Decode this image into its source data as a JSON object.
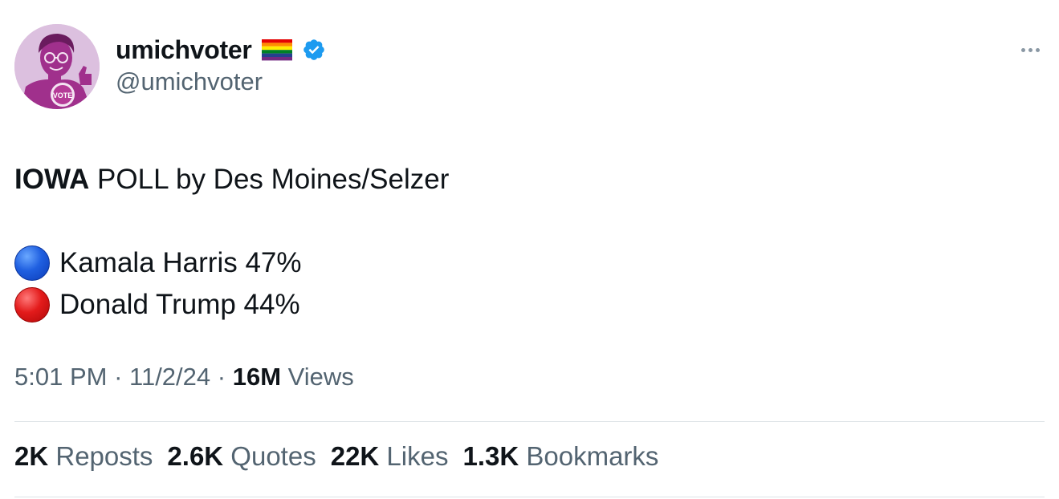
{
  "author": {
    "display_name": "umichvoter",
    "handle": "@umichvoter",
    "avatar_icon": "cartoon-avatar-vote",
    "avatar_badge_text": "VOTE",
    "flag_icon": "rainbow-flag-icon",
    "verified_icon": "verified-badge-icon",
    "verified_color": "#1d9bf0"
  },
  "tweet": {
    "title_bold": "IOWA",
    "title_rest": " POLL by Des Moines/Selzer",
    "lines": [
      {
        "icon": "blue-circle-icon",
        "text": "Kamala Harris 47%",
        "color": "#1f5fe0"
      },
      {
        "icon": "red-circle-icon",
        "text": "Donald Trump 44%",
        "color": "#e31b1b"
      }
    ]
  },
  "meta": {
    "time": "5:01 PM",
    "sep1": " · ",
    "date": "11/2/24",
    "sep2": " · ",
    "views_count": "16M",
    "views_label": " Views"
  },
  "stats": [
    {
      "count": "2K",
      "label": " Reposts"
    },
    {
      "count": "2.6K",
      "label": " Quotes"
    },
    {
      "count": "22K",
      "label": " Likes"
    },
    {
      "count": "1.3K",
      "label": " Bookmarks"
    }
  ],
  "colors": {
    "text_primary": "#0f1419",
    "text_secondary": "#536471",
    "divider": "#dde3e7",
    "avatar_bg": "#dcc0df"
  }
}
